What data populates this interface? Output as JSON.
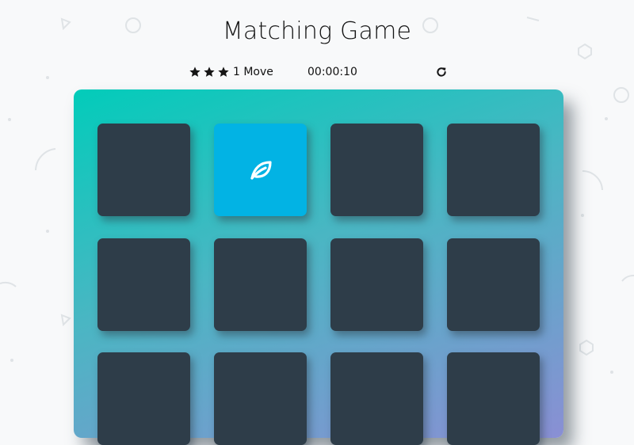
{
  "page": {
    "title": "Matching Game"
  },
  "score_panel": {
    "stars": 3,
    "moves": "1 Move",
    "timer": "00:00:10",
    "restart_icon": "restart-icon"
  },
  "deck": {
    "cards": [
      {
        "state": "hidden",
        "icon": null
      },
      {
        "state": "open",
        "icon": "leaf-icon"
      },
      {
        "state": "hidden",
        "icon": null
      },
      {
        "state": "hidden",
        "icon": null
      },
      {
        "state": "hidden",
        "icon": null
      },
      {
        "state": "hidden",
        "icon": null
      },
      {
        "state": "hidden",
        "icon": null
      },
      {
        "state": "hidden",
        "icon": null
      },
      {
        "state": "hidden",
        "icon": null
      },
      {
        "state": "hidden",
        "icon": null
      },
      {
        "state": "hidden",
        "icon": null
      },
      {
        "state": "hidden",
        "icon": null
      }
    ]
  },
  "colors": {
    "card_back": "#2e3d49",
    "card_open": "#02b3e4",
    "deck_gradient_start": "#02ccba",
    "deck_gradient_end": "#8a8fd4",
    "background": "#f8f9fa"
  }
}
